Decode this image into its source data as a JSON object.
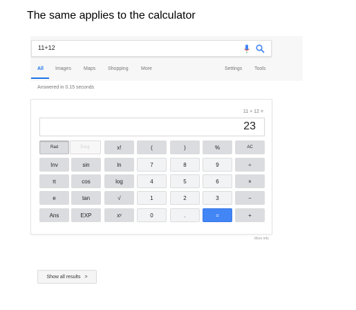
{
  "caption": "The same applies to the calculator",
  "search": {
    "query": "11+12",
    "icons": {
      "mic": "mic-icon",
      "search": "search-icon"
    }
  },
  "tabs": {
    "items": [
      "All",
      "Images",
      "Maps",
      "Shopping",
      "More"
    ],
    "right": [
      "Settings",
      "Tools"
    ],
    "active": "All"
  },
  "answered": "Answered in 0.15 seconds",
  "calculator": {
    "expression": "11 + 12 =",
    "result": "23",
    "keys": {
      "rad": "Rad",
      "deg": "Deg",
      "factorial": "x!",
      "open_paren": "(",
      "close_paren": ")",
      "percent": "%",
      "ac": "AC",
      "inv": "Inv",
      "sin": "sin",
      "ln": "ln",
      "seven": "7",
      "eight": "8",
      "nine": "9",
      "divide": "÷",
      "pi": "π",
      "cos": "cos",
      "log": "log",
      "four": "4",
      "five": "5",
      "six": "6",
      "multiply": "×",
      "e": "e",
      "tan": "tan",
      "sqrt": "√",
      "one": "1",
      "two": "2",
      "three": "3",
      "minus": "−",
      "ans": "Ans",
      "exp": "EXP",
      "power": "xʸ",
      "zero": "0",
      "dot": ".",
      "equals": "=",
      "plus": "+"
    },
    "more_info": "More info"
  },
  "show_all": {
    "label": "Show all results",
    "chevron": ">"
  },
  "colors": {
    "accent": "#1a73e8",
    "equals_key": "#4285f4"
  }
}
